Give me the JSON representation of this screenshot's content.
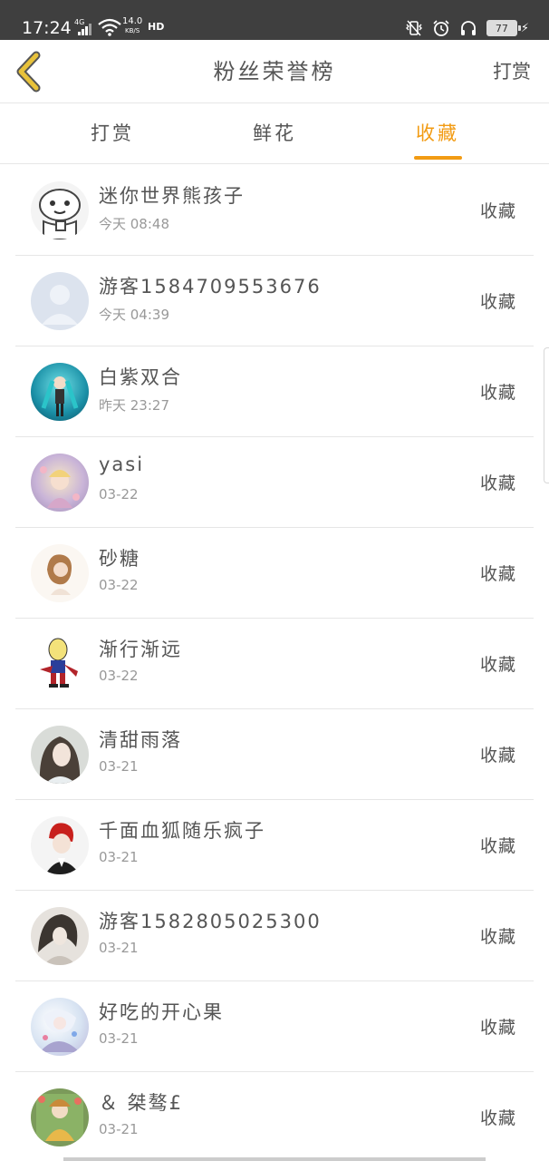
{
  "status_bar": {
    "time": "17:24",
    "network": "4G",
    "speed_value": "14.0",
    "speed_unit": "KB/S",
    "hd": "HD",
    "battery": "77"
  },
  "header": {
    "title": "粉丝荣誉榜",
    "action_label": "打赏"
  },
  "tabs": [
    {
      "label": "打赏",
      "active": false
    },
    {
      "label": "鲜花",
      "active": false
    },
    {
      "label": "收藏",
      "active": true
    }
  ],
  "list": {
    "items": [
      {
        "name": "迷你世界熊孩子",
        "time": "今天 08:48",
        "action": "收藏"
      },
      {
        "name": "游客1584709553676",
        "time": "今天 04:39",
        "action": "收藏"
      },
      {
        "name": "白紫双合",
        "time": "昨天 23:27",
        "action": "收藏"
      },
      {
        "name": "yasi",
        "time": "03-22",
        "action": "收藏"
      },
      {
        "name": "砂糖",
        "time": "03-22",
        "action": "收藏"
      },
      {
        "name": "渐行渐远",
        "time": "03-22",
        "action": "收藏"
      },
      {
        "name": "清甜雨落",
        "time": "03-21",
        "action": "收藏"
      },
      {
        "name": "千面血狐随乐疯子",
        "time": "03-21",
        "action": "收藏"
      },
      {
        "name": "游客1582805025300",
        "time": "03-21",
        "action": "收藏"
      },
      {
        "name": "好吃的开心果",
        "time": "03-21",
        "action": "收藏"
      },
      {
        "name": "＆ 桀骜£",
        "time": "03-21",
        "action": "收藏"
      }
    ]
  },
  "colors": {
    "accent": "#f29b13",
    "status_bar": "#3f3f3f",
    "back_icon": "#e8c23a",
    "divider": "#e6e6e6"
  }
}
